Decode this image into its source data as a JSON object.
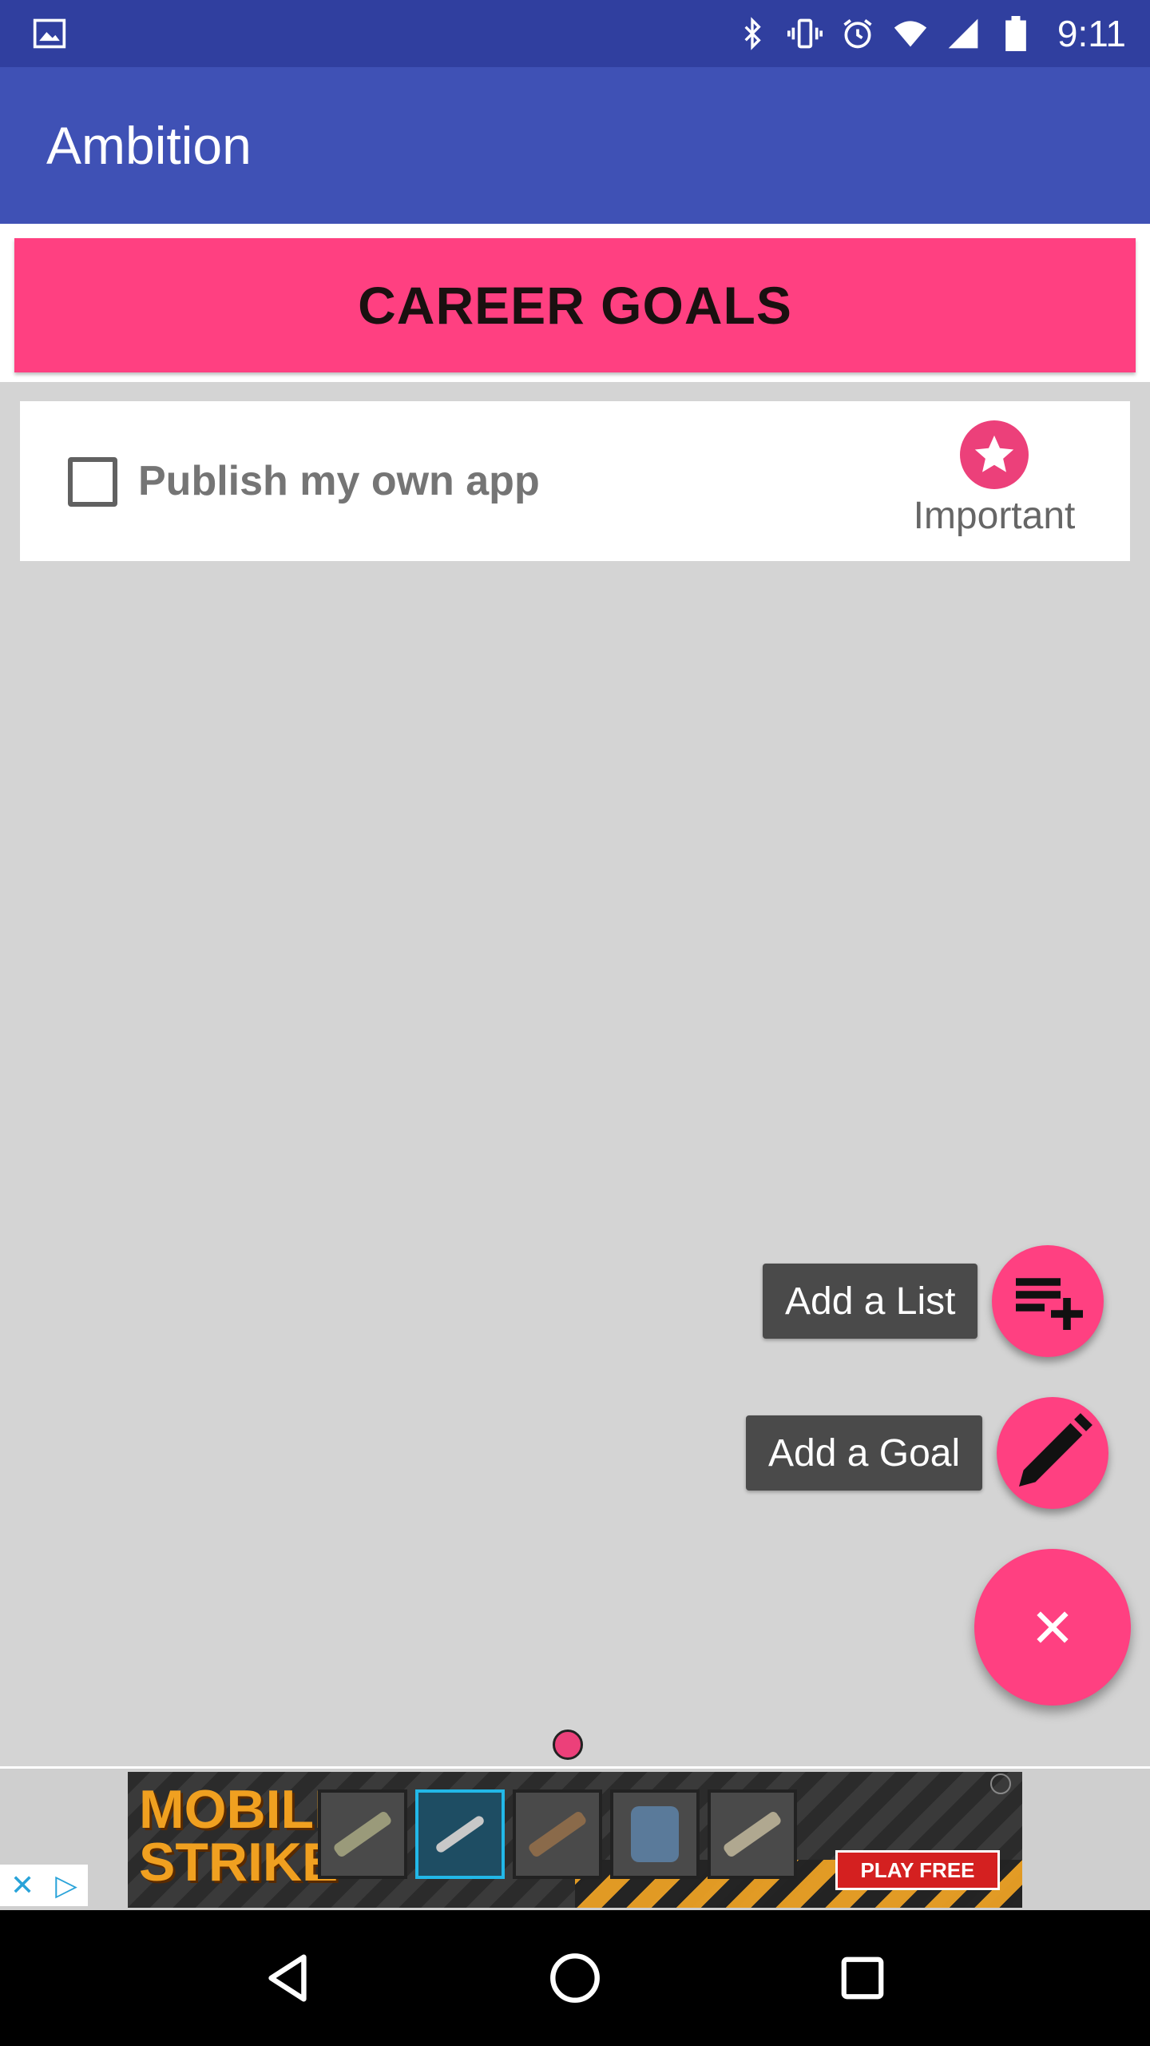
{
  "status_bar": {
    "time": "9:11",
    "icons": [
      "image-icon",
      "bluetooth-icon",
      "vibrate-icon",
      "alarm-icon",
      "wifi-icon",
      "cell-signal-icon",
      "battery-icon"
    ]
  },
  "app_bar": {
    "title": "Ambition"
  },
  "category": {
    "title": "CAREER GOALS"
  },
  "goals": [
    {
      "text": "Publish my own app",
      "checked": false,
      "badge_label": "Important"
    }
  ],
  "fab_menu": {
    "items": [
      {
        "label": "Add a List",
        "icon": "playlist-add-icon"
      },
      {
        "label": "Add a Goal",
        "icon": "pencil-icon"
      }
    ],
    "main_icon": "close-icon"
  },
  "ad": {
    "logo_line1": "MOBILE",
    "logo_line2": "STRIKE",
    "cta": "PLAY FREE"
  },
  "colors": {
    "status_bar": "#303f9f",
    "app_bar": "#3f51b5",
    "accent": "#ff4081",
    "background": "#d4d4d4"
  }
}
